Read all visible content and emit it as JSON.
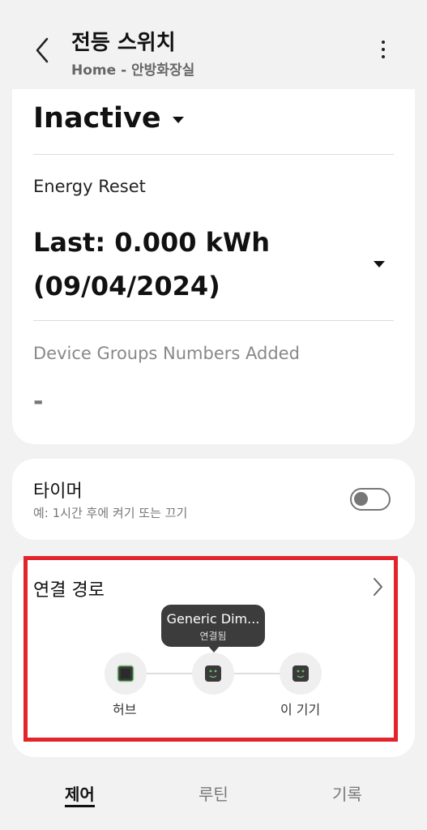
{
  "header": {
    "title": "전등 스위치",
    "subtitle": "Home - 안방화장실"
  },
  "status": {
    "value": "Inactive"
  },
  "energy": {
    "label": "Energy Reset",
    "value_line1": "Last: 0.000 kWh",
    "value_line2": "(09/04/2024)"
  },
  "groups": {
    "label": "Device Groups Numbers Added",
    "value": "-"
  },
  "timer": {
    "title": "타이머",
    "description": "예: 1시간 후에 켜기 또는 끄기",
    "enabled": false
  },
  "connection": {
    "title": "연결 경로",
    "tooltip_title": "Generic Dim...",
    "tooltip_status": "연결됨",
    "nodes": [
      "허브",
      "",
      "이 기기"
    ]
  },
  "nav": {
    "items": [
      "제어",
      "루틴",
      "기록"
    ],
    "active": "제어"
  },
  "colors": {
    "highlight": "#e2242b",
    "node_icon": "#6fbf73"
  }
}
